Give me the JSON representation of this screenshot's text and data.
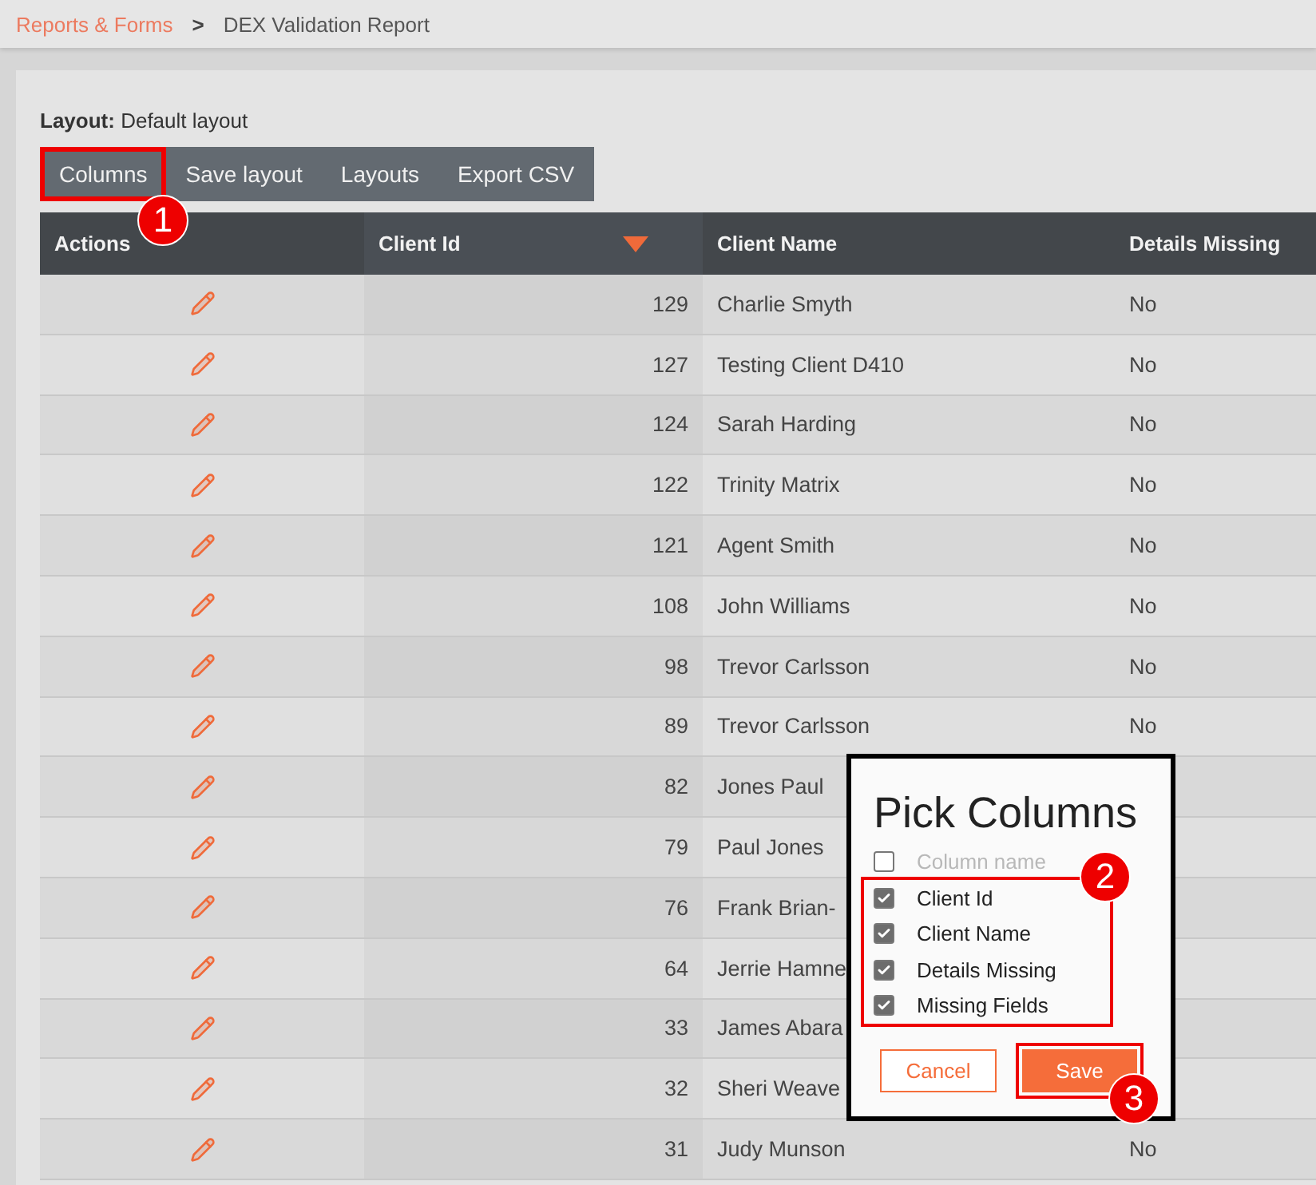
{
  "breadcrumb": {
    "parent": "Reports & Forms",
    "separator": ">",
    "current": "DEX Validation Report"
  },
  "layout": {
    "label": "Layout:",
    "value": "Default layout"
  },
  "toolbar": [
    {
      "label": "Columns",
      "highlighted": true
    },
    {
      "label": "Save layout",
      "highlighted": false
    },
    {
      "label": "Layouts",
      "highlighted": false
    },
    {
      "label": "Export CSV",
      "highlighted": false
    }
  ],
  "table": {
    "columns": [
      {
        "label": "Actions",
        "sorted": false
      },
      {
        "label": "Client Id",
        "sorted": true
      },
      {
        "label": "Client Name",
        "sorted": false
      },
      {
        "label": "Details Missing",
        "sorted": false
      }
    ],
    "rows": [
      {
        "client_id": "129",
        "client_name": "Charlie Smyth",
        "details_missing": "No"
      },
      {
        "client_id": "127",
        "client_name": "Testing Client D410",
        "details_missing": "No"
      },
      {
        "client_id": "124",
        "client_name": "Sarah Harding",
        "details_missing": "No"
      },
      {
        "client_id": "122",
        "client_name": "Trinity Matrix",
        "details_missing": "No"
      },
      {
        "client_id": "121",
        "client_name": "Agent Smith",
        "details_missing": "No"
      },
      {
        "client_id": "108",
        "client_name": "John Williams",
        "details_missing": "No"
      },
      {
        "client_id": "98",
        "client_name": "Trevor Carlsson",
        "details_missing": "No"
      },
      {
        "client_id": "89",
        "client_name": "Trevor Carlsson",
        "details_missing": "No"
      },
      {
        "client_id": "82",
        "client_name": "Jones Paul"
      },
      {
        "client_id": "79",
        "client_name": "Paul Jones"
      },
      {
        "client_id": "76",
        "client_name": "Frank Brian-"
      },
      {
        "client_id": "64",
        "client_name": "Jerrie Hamne"
      },
      {
        "client_id": "33",
        "client_name": "James Abara"
      },
      {
        "client_id": "32",
        "client_name": "Sheri Weave"
      },
      {
        "client_id": "31",
        "client_name": "Judy Munson",
        "details_missing": "No"
      }
    ]
  },
  "dialog": {
    "title": "Pick Columns",
    "header_option": {
      "label": "Column name",
      "checked": false
    },
    "options": [
      {
        "label": "Client Id",
        "checked": true
      },
      {
        "label": "Client Name",
        "checked": true
      },
      {
        "label": "Details Missing",
        "checked": true
      },
      {
        "label": "Missing Fields",
        "checked": true
      }
    ],
    "buttons": [
      {
        "label": "Cancel",
        "kind": "secondary",
        "highlighted": false
      },
      {
        "label": "Save",
        "kind": "primary",
        "highlighted": true
      }
    ]
  },
  "callouts": [
    {
      "number": "1"
    },
    {
      "number": "2"
    },
    {
      "number": "3"
    }
  ]
}
